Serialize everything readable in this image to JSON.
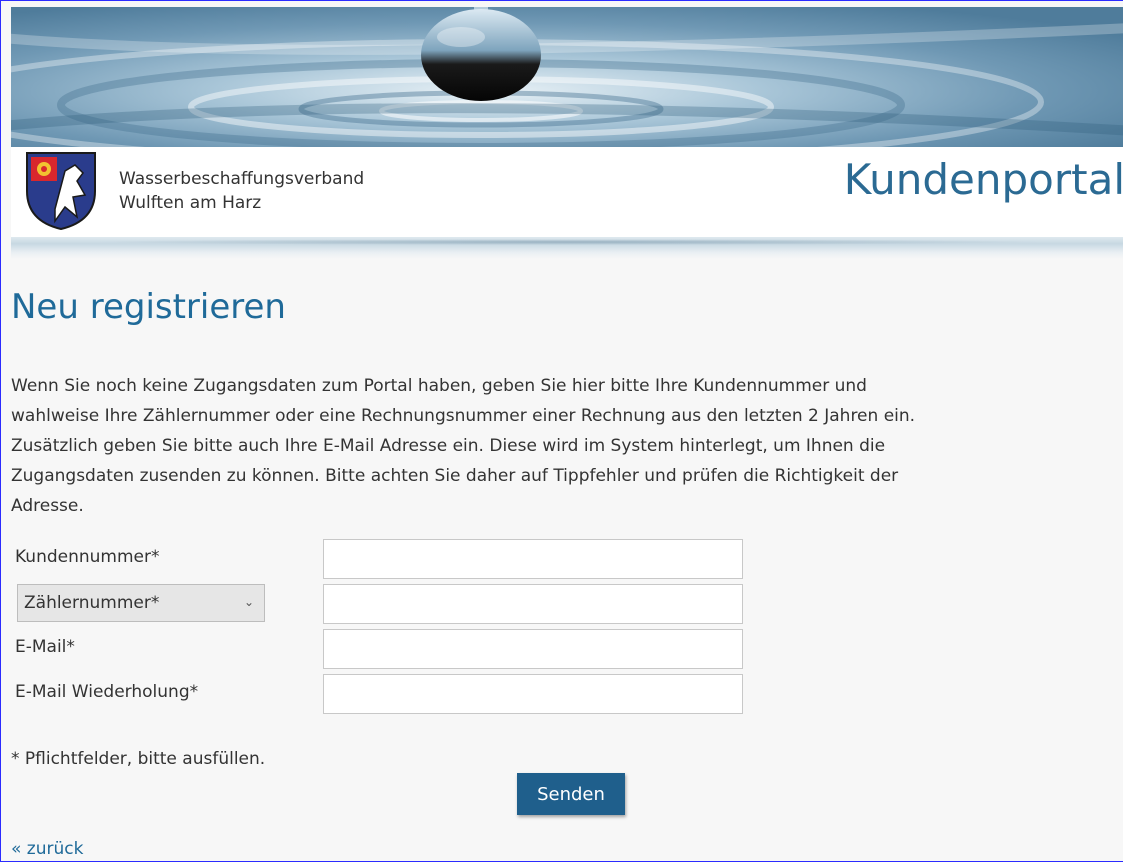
{
  "header": {
    "org_line1": "Wasserbeschaffungsverband",
    "org_line2": "Wulften am Harz",
    "portal_title": "Kundenportal",
    "crest_icon": "coat-of-arms-icon"
  },
  "main": {
    "heading": "Neu registrieren",
    "intro": "Wenn Sie noch keine Zugangsdaten zum Portal haben, geben Sie hier bitte Ihre Kundennummer und\nwahlweise Ihre Zählernummer oder eine Rechnungsnummer einer Rechnung aus den letzten 2 Jahren ein.\nZusätzlich geben Sie bitte auch Ihre E-Mail Adresse ein. Diese wird im System hinterlegt, um Ihnen die\nZugangsdaten zusenden zu können. Bitte achten Sie daher auf Tippfehler und prüfen die Richtigkeit der\nAdresse."
  },
  "form": {
    "customer_label": "Kundennummer*",
    "customer_value": "",
    "number_type_selected": "Zählernummer*",
    "number_value": "",
    "email_label": "E-Mail*",
    "email_value": "",
    "email_repeat_label": "E-Mail Wiederholung*",
    "email_repeat_value": "",
    "required_note": "* Pflichtfelder, bitte ausfüllen.",
    "submit_label": "Senden"
  },
  "footer": {
    "back_link": "« zurück"
  },
  "colors": {
    "accent": "#1f6a99",
    "button": "#1f5f8c"
  }
}
